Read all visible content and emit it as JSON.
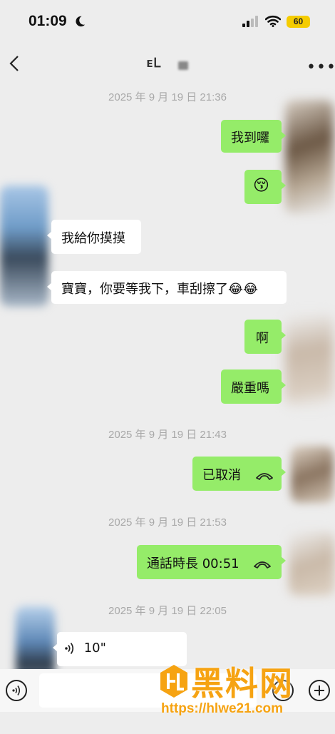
{
  "status_bar": {
    "time": "01:09",
    "battery": "60",
    "icons": [
      "moon-icon",
      "signal-icon",
      "wifi-icon",
      "battery-icon"
    ]
  },
  "nav": {
    "title": "ᴇᏞ",
    "back_icon": "chevron-left-icon",
    "more_icon": "more-icon"
  },
  "timestamps": [
    "2025 年 9 月 19 日 21:36",
    "2025 年 9 月 19 日 21:43",
    "2025 年 9 月 19 日 21:53",
    "2025 年 9 月 19 日 22:05"
  ],
  "messages": [
    {
      "side": "out",
      "text": "我到囉"
    },
    {
      "side": "out",
      "text": "😚"
    },
    {
      "side": "in",
      "text": "我給你摸摸"
    },
    {
      "side": "in",
      "text": "寶寶，你要等我下，車刮擦了😂😂"
    },
    {
      "side": "out",
      "text": "啊"
    },
    {
      "side": "out",
      "text": "嚴重嗎"
    },
    {
      "side": "out",
      "text": "已取消"
    },
    {
      "side": "out",
      "text": "通話時長 00:51"
    },
    {
      "side": "in",
      "text": "10\""
    }
  ],
  "input_bar": {
    "voice_icon": "voice-mode-icon",
    "emoji_icon": "emoji-icon",
    "plus_icon": "plus-icon"
  },
  "watermark": {
    "brand": "黑料网",
    "url": "https://hlwe21.com"
  },
  "colors": {
    "outgoing": "#95ec69",
    "incoming": "#ffffff",
    "background": "#ededed",
    "watermark": "#f6a312"
  }
}
